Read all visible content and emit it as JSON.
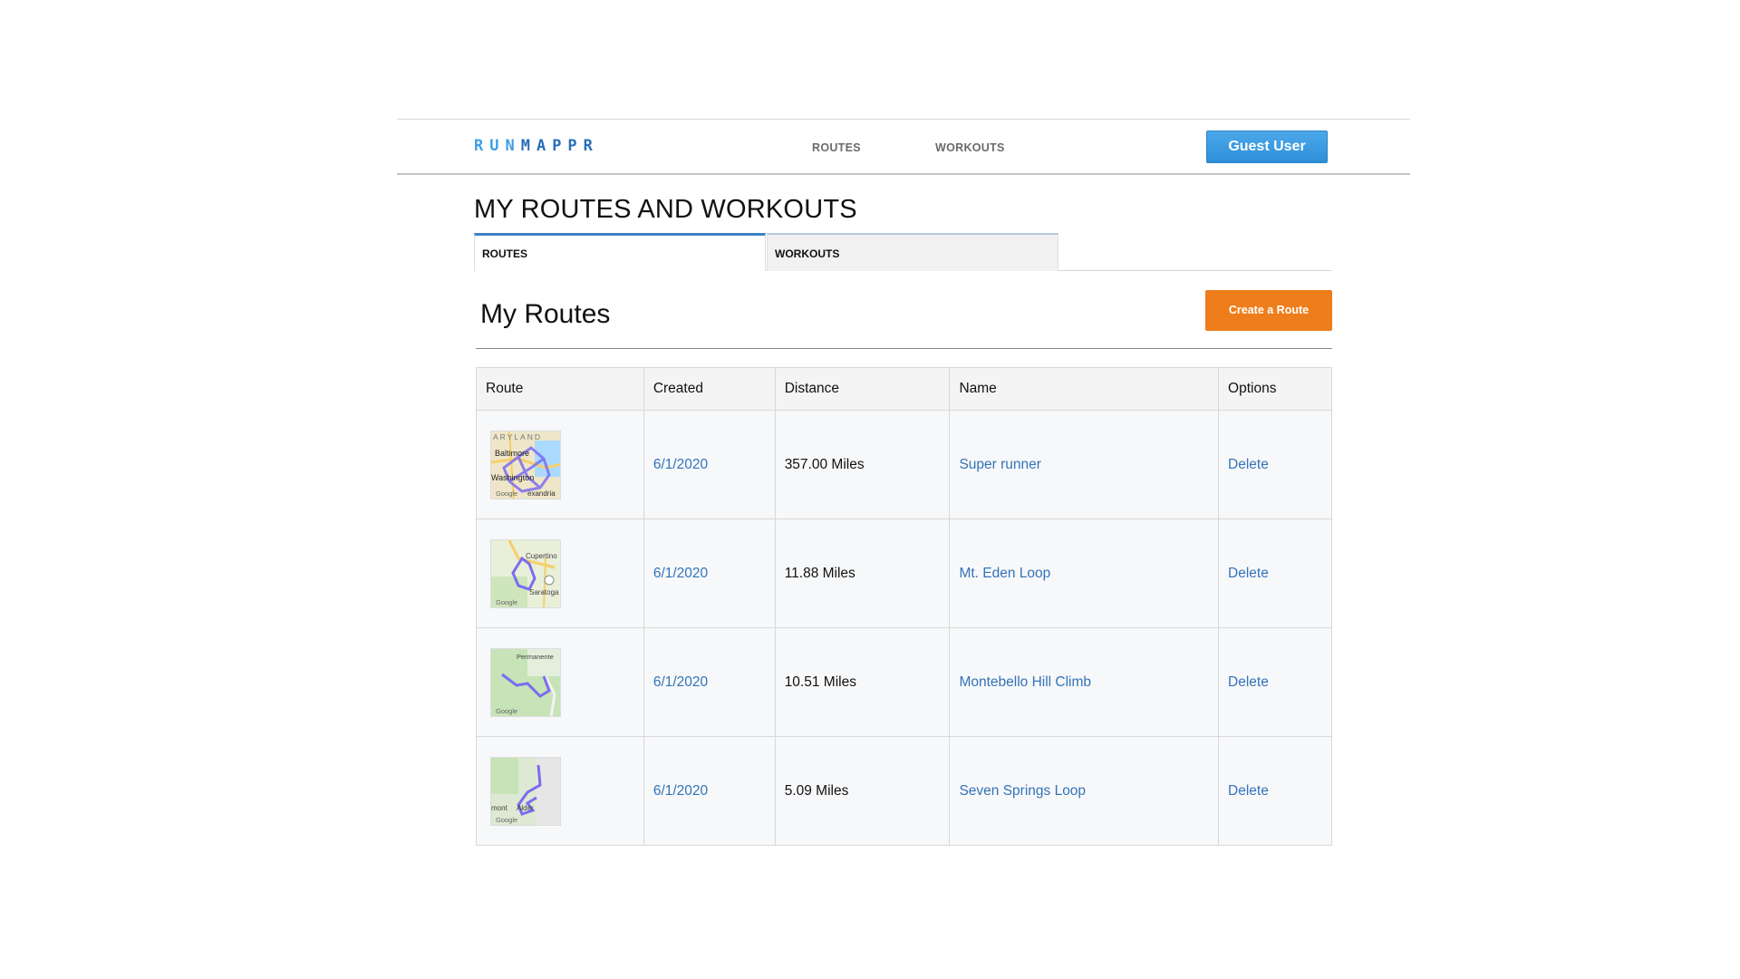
{
  "header": {
    "logo_part1": "RUN",
    "logo_part2": "MAPPR",
    "nav": [
      {
        "label": "ROUTES"
      },
      {
        "label": "WORKOUTS"
      }
    ],
    "user_button": "Guest User"
  },
  "page": {
    "title": "MY ROUTES AND WORKOUTS",
    "tabs": [
      {
        "label": "ROUTES",
        "active": true
      },
      {
        "label": "WORKOUTS",
        "active": false
      }
    ],
    "section_title": "My Routes",
    "create_button": "Create a Route"
  },
  "table": {
    "columns": [
      "Route",
      "Created",
      "Distance",
      "Name",
      "Options"
    ],
    "rows": [
      {
        "map_icon": "route-map-thumbnail",
        "map_labels": [
          "ARYLAND",
          "Baltimore",
          "Washington",
          "Google",
          "exandria"
        ],
        "created": "6/1/2020",
        "distance": "357.00 Miles",
        "name": "Super runner",
        "option": "Delete"
      },
      {
        "map_icon": "route-map-thumbnail",
        "map_labels": [
          "Cupertino",
          "Saratoga",
          "Google"
        ],
        "created": "6/1/2020",
        "distance": "11.88 Miles",
        "name": "Mt. Eden Loop",
        "option": "Delete"
      },
      {
        "map_icon": "route-map-thumbnail",
        "map_labels": [
          "Permanente",
          "Google"
        ],
        "created": "6/1/2020",
        "distance": "10.51 Miles",
        "name": "Montebello Hill Climb",
        "option": "Delete"
      },
      {
        "map_icon": "route-map-thumbnail",
        "map_labels": [
          "mont",
          "Alder",
          "Google"
        ],
        "created": "6/1/2020",
        "distance": "5.09 Miles",
        "name": "Seven Springs Loop",
        "option": "Delete"
      }
    ]
  },
  "colors": {
    "link": "#3373b8",
    "create_button": "#ee7d1b",
    "user_button": "#3a9be2",
    "route_line": "#7b6cf0"
  }
}
